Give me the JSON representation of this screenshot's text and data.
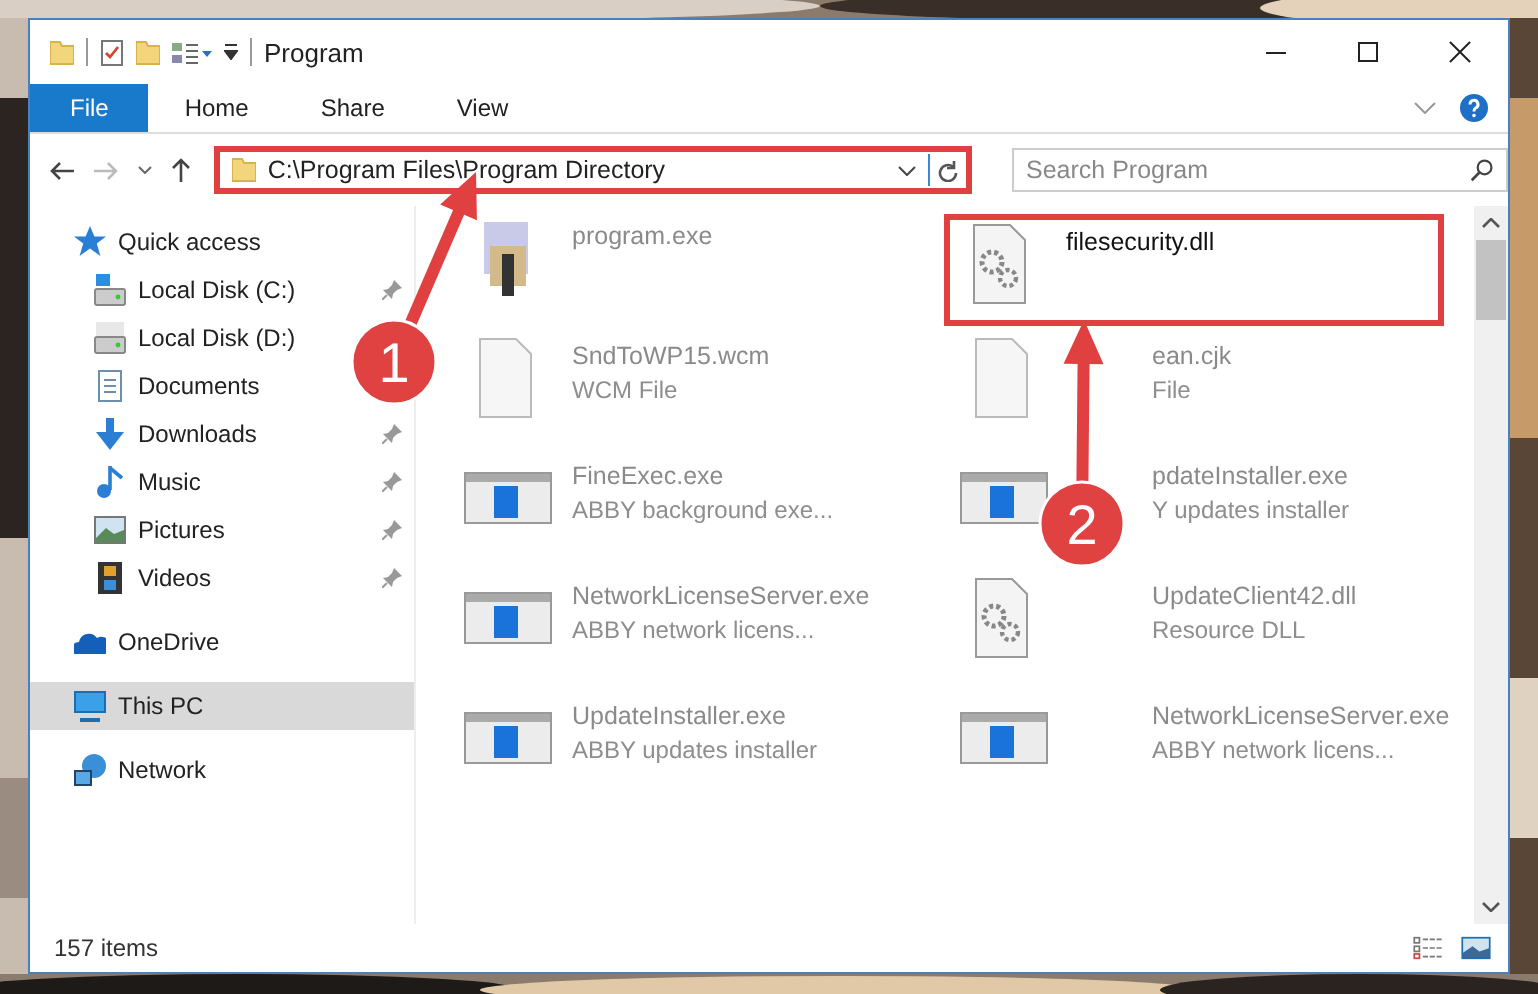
{
  "window": {
    "title": "Program"
  },
  "ribbon_tabs": [
    {
      "label": "File",
      "selected": true
    },
    {
      "label": "Home",
      "selected": false
    },
    {
      "label": "Share",
      "selected": false
    },
    {
      "label": "View",
      "selected": false
    }
  ],
  "address": {
    "path": "C:\\Program Files\\Program Directory",
    "highlighted": true
  },
  "search": {
    "placeholder": "Search Program"
  },
  "nav": [
    {
      "label": "Quick access",
      "kind": "star",
      "selected": false,
      "children": [
        {
          "label": "Local Disk (C:)",
          "kind": "windisk",
          "pinned": true,
          "selected": false
        },
        {
          "label": "Local Disk (D:)",
          "kind": "disk",
          "pinned": false,
          "selected": false
        },
        {
          "label": "Documents",
          "kind": "documents",
          "pinned": false,
          "selected": false
        },
        {
          "label": "Downloads",
          "kind": "downloads",
          "pinned": true,
          "selected": false
        },
        {
          "label": "Music",
          "kind": "music",
          "pinned": true,
          "selected": false
        },
        {
          "label": "Pictures",
          "kind": "pictures",
          "pinned": true,
          "selected": false
        },
        {
          "label": "Videos",
          "kind": "videos",
          "pinned": true,
          "selected": false
        }
      ]
    },
    {
      "label": "OneDrive",
      "kind": "cloud",
      "selected": false
    },
    {
      "label": "This PC",
      "kind": "computer",
      "selected": true
    },
    {
      "label": "Network",
      "kind": "network",
      "selected": false
    }
  ],
  "files": [
    {
      "name": "program.exe",
      "kind": "installer",
      "highlighted": false
    },
    {
      "name": "filesecurity.dll",
      "kind": "dll",
      "highlighted": true
    },
    {
      "name": "SndToWP15.wcm",
      "type": "WCM File",
      "kind": "blank",
      "highlighted": false
    },
    {
      "name": "ean.cjk",
      "type": "File",
      "kind": "blank",
      "highlighted": false
    },
    {
      "name": "FineExec.exe",
      "type": "ABBY background exe...",
      "kind": "exe",
      "highlighted": false
    },
    {
      "name": "pdateInstaller.exe",
      "type": "Y updates installer",
      "kind": "exe",
      "highlighted": false
    },
    {
      "name": "NetworkLicenseServer.exe",
      "type": "ABBY network licens...",
      "kind": "exe",
      "highlighted": false
    },
    {
      "name": "UpdateClient42.dll",
      "type": "Resource DLL",
      "kind": "dll",
      "highlighted": false
    },
    {
      "name": "UpdateInstaller.exe",
      "type": "ABBY updates installer",
      "kind": "exe",
      "highlighted": false
    },
    {
      "name": "NetworkLicenseServer.exe",
      "type": "ABBY network licens...",
      "kind": "exe",
      "highlighted": false
    }
  ],
  "callouts": [
    {
      "number": "1"
    },
    {
      "number": "2"
    }
  ],
  "status_bar": {
    "count": "157 items"
  }
}
